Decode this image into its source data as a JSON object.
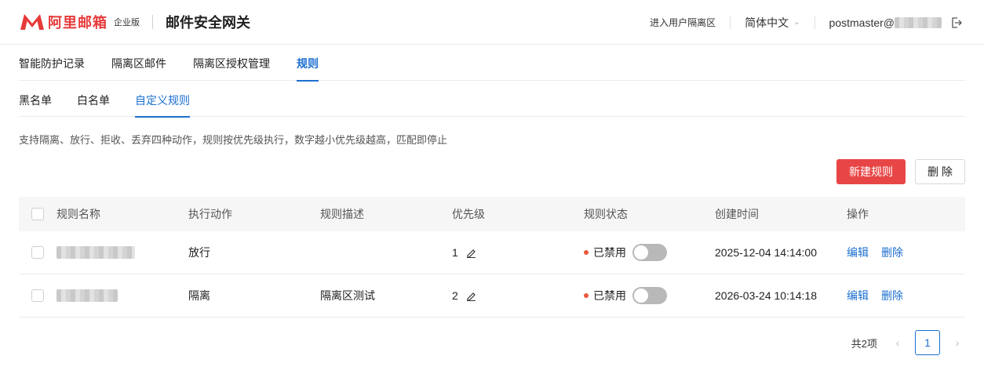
{
  "header": {
    "brand": "阿里邮箱",
    "edition": "企业版",
    "app_title": "邮件安全网关",
    "quarantine_link": "进入用户隔离区",
    "language": "简体中文",
    "user_prefix": "postmaster@"
  },
  "top_tabs": [
    {
      "label": "智能防护记录"
    },
    {
      "label": "隔离区邮件"
    },
    {
      "label": "隔离区授权管理"
    },
    {
      "label": "规则"
    }
  ],
  "sub_tabs": [
    {
      "label": "黑名单"
    },
    {
      "label": "白名单"
    },
    {
      "label": "自定义规则"
    }
  ],
  "description": "支持隔离、放行、拒收、丢弃四种动作，规则按优先级执行，数字越小优先级越高，匹配即停止",
  "buttons": {
    "new_rule": "新建规则",
    "delete": "删 除"
  },
  "table": {
    "columns": [
      "规则名称",
      "执行动作",
      "规则描述",
      "优先级",
      "规则状态",
      "创建时间",
      "操作"
    ],
    "rows": [
      {
        "action": "放行",
        "description": "",
        "priority": "1",
        "status": "已禁用",
        "created": "2025-12-04 14:14:00",
        "op_edit": "编辑",
        "op_delete": "删除"
      },
      {
        "action": "隔离",
        "description": "隔离区测试",
        "priority": "2",
        "status": "已禁用",
        "created": "2026-03-24 10:14:18",
        "op_edit": "编辑",
        "op_delete": "删除"
      }
    ]
  },
  "pagination": {
    "total": "共2项",
    "current_page": "1"
  },
  "colors": {
    "brand_red": "#e63a3a",
    "primary_blue": "#1c6fd0",
    "danger_button": "#e84646",
    "status_dot": "#e8583a"
  }
}
